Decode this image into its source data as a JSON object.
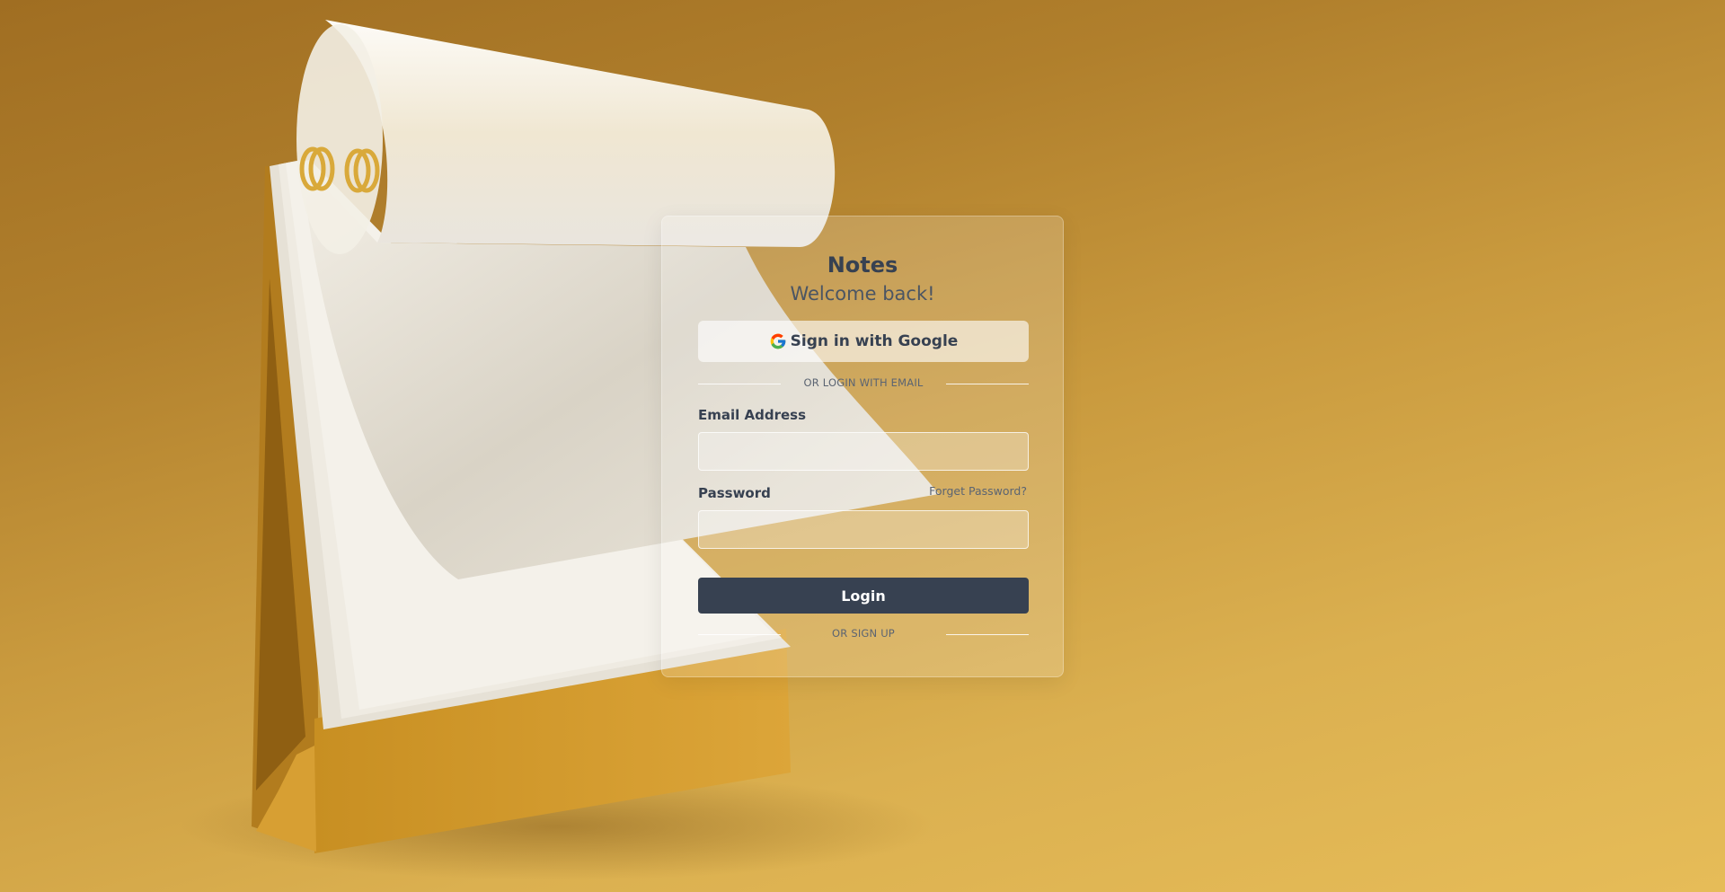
{
  "background": {
    "description_colors": [
      "#a06e22",
      "#e6bc58"
    ]
  },
  "card": {
    "title": "Notes",
    "subtitle": "Welcome back!",
    "google_button": {
      "label": "Sign in with Google",
      "icon": "google-g-icon"
    },
    "divider_email": "OR LOGIN WITH EMAIL",
    "email": {
      "label": "Email Address",
      "value": "",
      "placeholder": ""
    },
    "password": {
      "label": "Password",
      "forgot_link": "Forget Password?",
      "value": "",
      "placeholder": ""
    },
    "login_button": "Login",
    "divider_signup": "OR SIGN UP"
  },
  "colors": {
    "primary_button": "#374151",
    "text_dark": "#374151",
    "text_muted": "#5b6472"
  }
}
